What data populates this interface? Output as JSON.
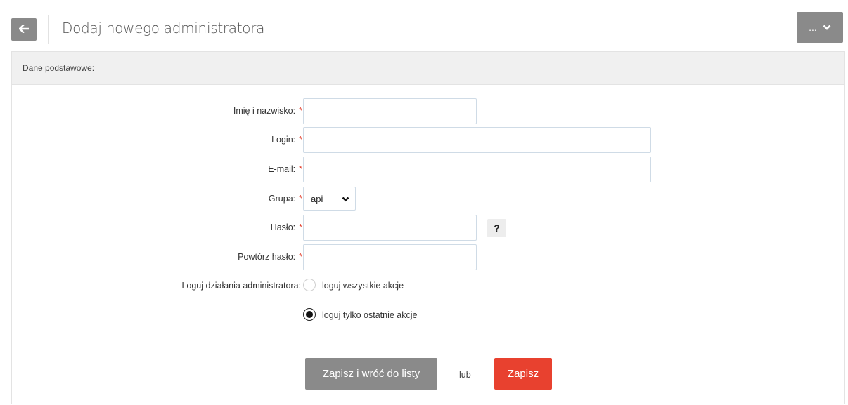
{
  "header": {
    "title": "Dodaj nowego administratora",
    "more_label": "..."
  },
  "section": {
    "title": "Dane podstawowe:"
  },
  "form": {
    "required_mark": "*",
    "name_label": "Imię i nazwisko:",
    "name_value": "",
    "login_label": "Login:",
    "login_value": "",
    "email_label": "E-mail:",
    "email_value": "",
    "group_label": "Grupa:",
    "group_value": "api",
    "password_label": "Hasło:",
    "password_value": "",
    "help_label": "?",
    "repeat_password_label": "Powtórz hasło:",
    "repeat_password_value": "",
    "log_label": "Loguj działania administratora:",
    "log_options": [
      {
        "label": "loguj wszystkie akcje",
        "checked": false
      },
      {
        "label": "loguj tylko ostatnie akcje",
        "checked": true
      }
    ]
  },
  "actions": {
    "save_and_return_label": "Zapisz i wróć do listy",
    "or_label": "lub",
    "save_label": "Zapisz"
  },
  "colors": {
    "accent_red": "#e8412f",
    "button_gray": "#8a8a8a",
    "section_bg": "#f0f0f0"
  }
}
